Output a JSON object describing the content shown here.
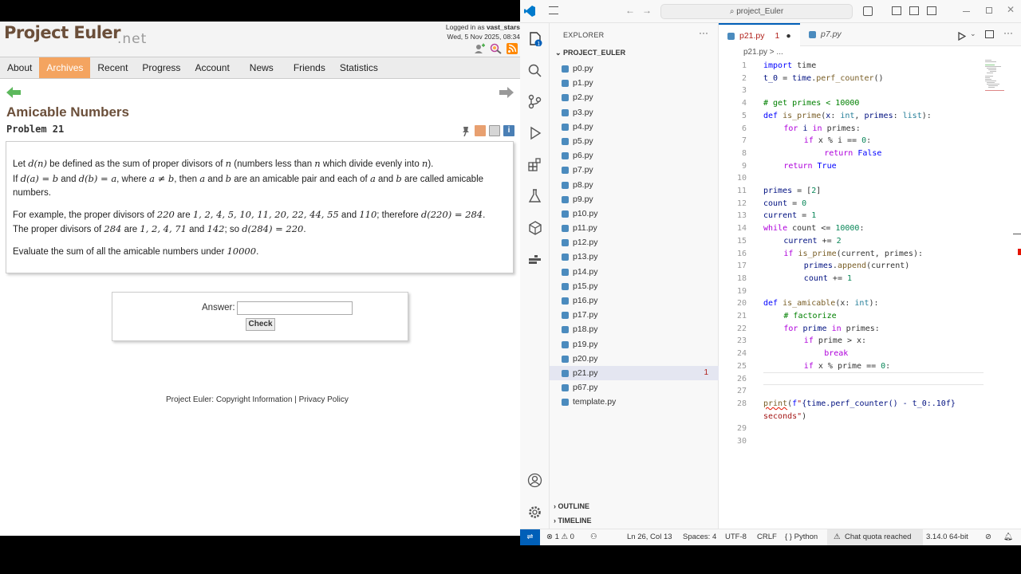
{
  "browser": {
    "logo": "Project Euler",
    "logo_suffix": ".net",
    "login_line1_prefix": "Logged in as ",
    "login_user": "vast_stars",
    "login_line2": "Wed, 5 Nov 2025, 08:34",
    "nav": [
      "About",
      "Archives",
      "Recent",
      "Progress",
      "Account",
      "News",
      "Friends",
      "Statistics"
    ],
    "active_nav": "Archives",
    "problem_title": "Amicable Numbers",
    "problem_number": "Problem 21",
    "p1a": "Let ",
    "p1_dn": "d(n)",
    "p1b": " be defined as the sum of proper divisors of ",
    "p1_n": "n",
    "p1c": " (numbers less than ",
    "p1_n2": "n",
    "p1d": " which divide evenly into ",
    "p1_n3": "n",
    "p1e": ").",
    "p1f": "If ",
    "p1_da": "d(a) = b",
    "p1g": " and ",
    "p1_db": "d(b) = a",
    "p1h": ", where ",
    "p1_anb": "a ≠ b",
    "p1i": ", then ",
    "p1_a": "a",
    "p1j": " and ",
    "p1_b": "b",
    "p1k": " are an amicable pair and each of ",
    "p1_a2": "a",
    "p1l": " and ",
    "p1_b2": "b",
    "p1m": " are called amicable numbers.",
    "p2a": "For example, the proper divisors of ",
    "p2_220": "220",
    "p2b": " are ",
    "p2_list1": "1, 2, 4, 5, 10, 11, 20, 22, 44, 55",
    "p2c": " and ",
    "p2_110": "110",
    "p2d": "; therefore ",
    "p2_d220": "d(220) = 284",
    "p2e": ".",
    "p2f": "The proper divisors of ",
    "p2_284": "284",
    "p2g": " are ",
    "p2_list2": "1, 2, 4, 71",
    "p2h": " and ",
    "p2_142": "142",
    "p2i": "; so ",
    "p2_d284": "d(284) = 220",
    "p2j": ".",
    "p3a": "Evaluate the sum of all the amicable numbers under ",
    "p3_10000": "10000",
    "p3b": ".",
    "answer_label": "Answer:",
    "answer_value": "",
    "check_label": "Check",
    "footer_prefix": "Project Euler: ",
    "footer_link1": "Copyright Information",
    "footer_sep": " | ",
    "footer_link2": "Privacy Policy"
  },
  "vscode": {
    "search": "project_Euler",
    "explorer_title": "EXPLORER",
    "project": "PROJECT_EULER",
    "files": [
      "p0.py",
      "p1.py",
      "p2.py",
      "p3.py",
      "p4.py",
      "p5.py",
      "p6.py",
      "p7.py",
      "p8.py",
      "p9.py",
      "p10.py",
      "p11.py",
      "p12.py",
      "p13.py",
      "p14.py",
      "p15.py",
      "p16.py",
      "p17.py",
      "p18.py",
      "p19.py",
      "p20.py",
      "p21.py",
      "p67.py",
      "template.py"
    ],
    "active_file": "p21.py",
    "active_file_badge": "1",
    "outline": "OUTLINE",
    "timeline": "TIMELINE",
    "tab_active": "p21.py",
    "tab_active_badge": "1",
    "tab_2": "p7.py",
    "breadcrumb": "p21.py > ...",
    "line_numbers": [
      "1",
      "2",
      "3",
      "4",
      "5",
      "6",
      "7",
      "8",
      "9",
      "10",
      "11",
      "12",
      "13",
      "14",
      "15",
      "16",
      "17",
      "18",
      "19",
      "20",
      "21",
      "22",
      "23",
      "24",
      "25",
      "26",
      "27",
      "28",
      "",
      "29",
      "30"
    ],
    "code": {
      "l1_kw": "import",
      "l1_rest": " time",
      "l2_a": "t_0",
      "l2_b": " = ",
      "l2_c": "time",
      "l2_d": ".",
      "l2_e": "perf_counter",
      "l2_f": "()",
      "l4": "# get primes < 10000",
      "l5_kw": "def",
      "l5_fn": " is_prime",
      "l5_a": "(",
      "l5_x": "x",
      "l5_b": ": ",
      "l5_int": "int",
      "l5_c": ", ",
      "l5_p": "primes",
      "l5_d": ": ",
      "l5_list": "list",
      "l5_e": "):",
      "l6_kw": "for",
      "l6_i": " i ",
      "l6_in": "in",
      "l6_rest": " primes:",
      "l7_kw": "if",
      "l7_rest": " x % i == ",
      "l7_n": "0",
      "l7_end": ":",
      "l8_kw": "return",
      "l8_v": " False",
      "l9_kw": "return",
      "l9_v": " True",
      "l11_a": "primes",
      "l11_b": " = [",
      "l11_n": "2",
      "l11_c": "]",
      "l12_a": "count",
      "l12_b": " = ",
      "l12_n": "0",
      "l13_a": "current",
      "l13_b": " = ",
      "l13_n": "1",
      "l14_kw": "while",
      "l14_a": " count <= ",
      "l14_n": "10000",
      "l14_b": ":",
      "l15_a": "current",
      "l15_b": " += ",
      "l15_n": "2",
      "l16_kw": "if",
      "l16_fn": " is_prime",
      "l16_rest": "(current, primes):",
      "l17_a": "primes",
      "l17_b": ".",
      "l17_fn": "append",
      "l17_c": "(current)",
      "l18_a": "count",
      "l18_b": " += ",
      "l18_n": "1",
      "l20_kw": "def",
      "l20_fn": " is_amicable",
      "l20_a": "(x: ",
      "l20_int": "int",
      "l20_b": "):",
      "l21": "# factorize",
      "l22_kw": "for",
      "l22_a": " prime ",
      "l22_in": "in",
      "l22_b": " primes:",
      "l23_kw": "if",
      "l23_rest": " prime > x:",
      "l24_kw": "break",
      "l25_kw": "if",
      "l25_rest": " x % prime == ",
      "l25_n": "0",
      "l25_end": ":",
      "l28_fn": "print",
      "l28_a": "(",
      "l28_f": "f",
      "l28_s1": "\"",
      "l28_expr": "{time.perf_counter() - t_0:.10f}",
      "l28_s2": "",
      "l28b_s": "seconds\"",
      "l28b_end": ")"
    },
    "status": {
      "problems": "⊗ 1 ⚠ 0",
      "position": "Ln 26, Col 13",
      "spaces": "Spaces: 4",
      "encoding": "UTF-8",
      "eol": "CRLF",
      "language": "{ } Python",
      "quota": "Chat quota reached",
      "python_version": "3.14.0 64-bit"
    },
    "accent": "#005fb8"
  }
}
